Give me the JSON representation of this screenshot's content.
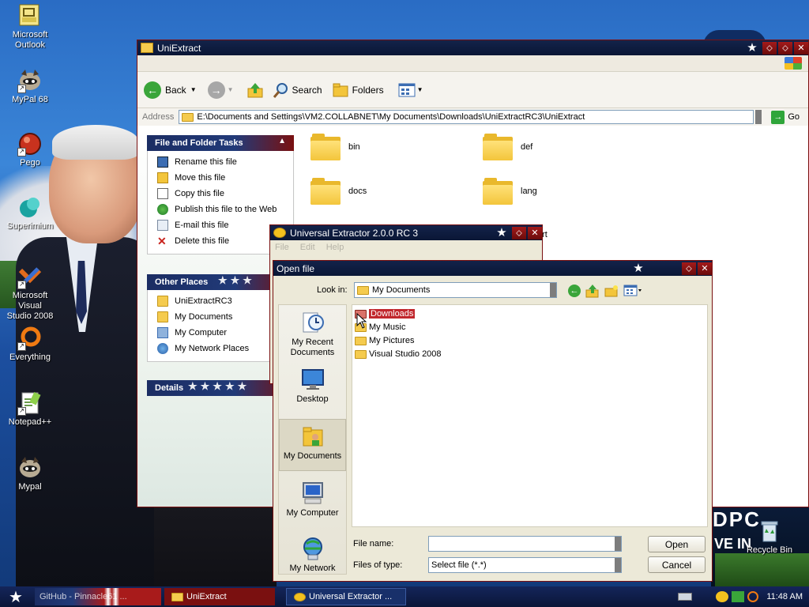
{
  "colors": {
    "accent_red": "#a81b1b",
    "navy": "#13234a",
    "selection": "#c1272d"
  },
  "desktop": {
    "icons": [
      {
        "label": "Microsoft\nOutlook",
        "icon": "outlook-icon"
      },
      {
        "label": "MyPal 68",
        "icon": "mypal-icon"
      },
      {
        "label": "Pego",
        "icon": "pego-icon"
      },
      {
        "label": "Superimium",
        "icon": "superimium-icon"
      },
      {
        "label": "Microsoft Visual\nStudio 2008",
        "icon": "visual-studio-icon"
      },
      {
        "label": "Everything",
        "icon": "everything-icon"
      },
      {
        "label": "Notepad++",
        "icon": "notepadpp-icon"
      },
      {
        "label": "Mypal",
        "icon": "mypal-icon"
      }
    ],
    "recycle_bin": "Recycle Bin",
    "wallpaper_text_1": "DPC",
    "wallpaper_text_2": "VE IN"
  },
  "explorer": {
    "title": "UniExtract",
    "toolbar": {
      "back": "Back",
      "search": "Search",
      "folders": "Folders"
    },
    "address_label": "Address",
    "address_value": "E:\\Documents and Settings\\VM2.COLLABNET\\My Documents\\Downloads\\UniExtractRC3\\UniExtract",
    "go_label": "Go",
    "tasks_panel": {
      "title": "File and Folder Tasks",
      "items": [
        "Rename this file",
        "Move this file",
        "Copy this file",
        "Publish this file to the Web",
        "E-mail this file",
        "Delete this file"
      ]
    },
    "other_places": {
      "title": "Other Places",
      "items": [
        "UniExtractRC3",
        "My Documents",
        "My Computer",
        "My Network Places"
      ]
    },
    "details": {
      "title": "Details"
    },
    "folders": [
      "bin",
      "def",
      "docs",
      "lang"
    ],
    "partial_item": "ort"
  },
  "uniextractor": {
    "title": "Universal Extractor 2.0.0 RC 3",
    "menu": [
      "File",
      "Edit",
      "Help"
    ]
  },
  "dialog": {
    "title": "Open file",
    "look_in_label": "Look in:",
    "look_in_value": "My Documents",
    "places": [
      "My Recent\nDocuments",
      "Desktop",
      "My Documents",
      "My Computer",
      "My Network"
    ],
    "files": [
      "Downloads",
      "My Music",
      "My Pictures",
      "Visual Studio 2008"
    ],
    "selected_file": "Downloads",
    "file_name_label": "File name:",
    "file_name_value": "",
    "file_type_label": "Files of type:",
    "file_type_value": "Select file (*.*)",
    "open_button": "Open",
    "cancel_button": "Cancel"
  },
  "taskbar": {
    "tasks": [
      "GitHub - Pinnacle61 ...",
      "UniExtract",
      "Universal Extractor ..."
    ],
    "clock": "11:48 AM"
  }
}
